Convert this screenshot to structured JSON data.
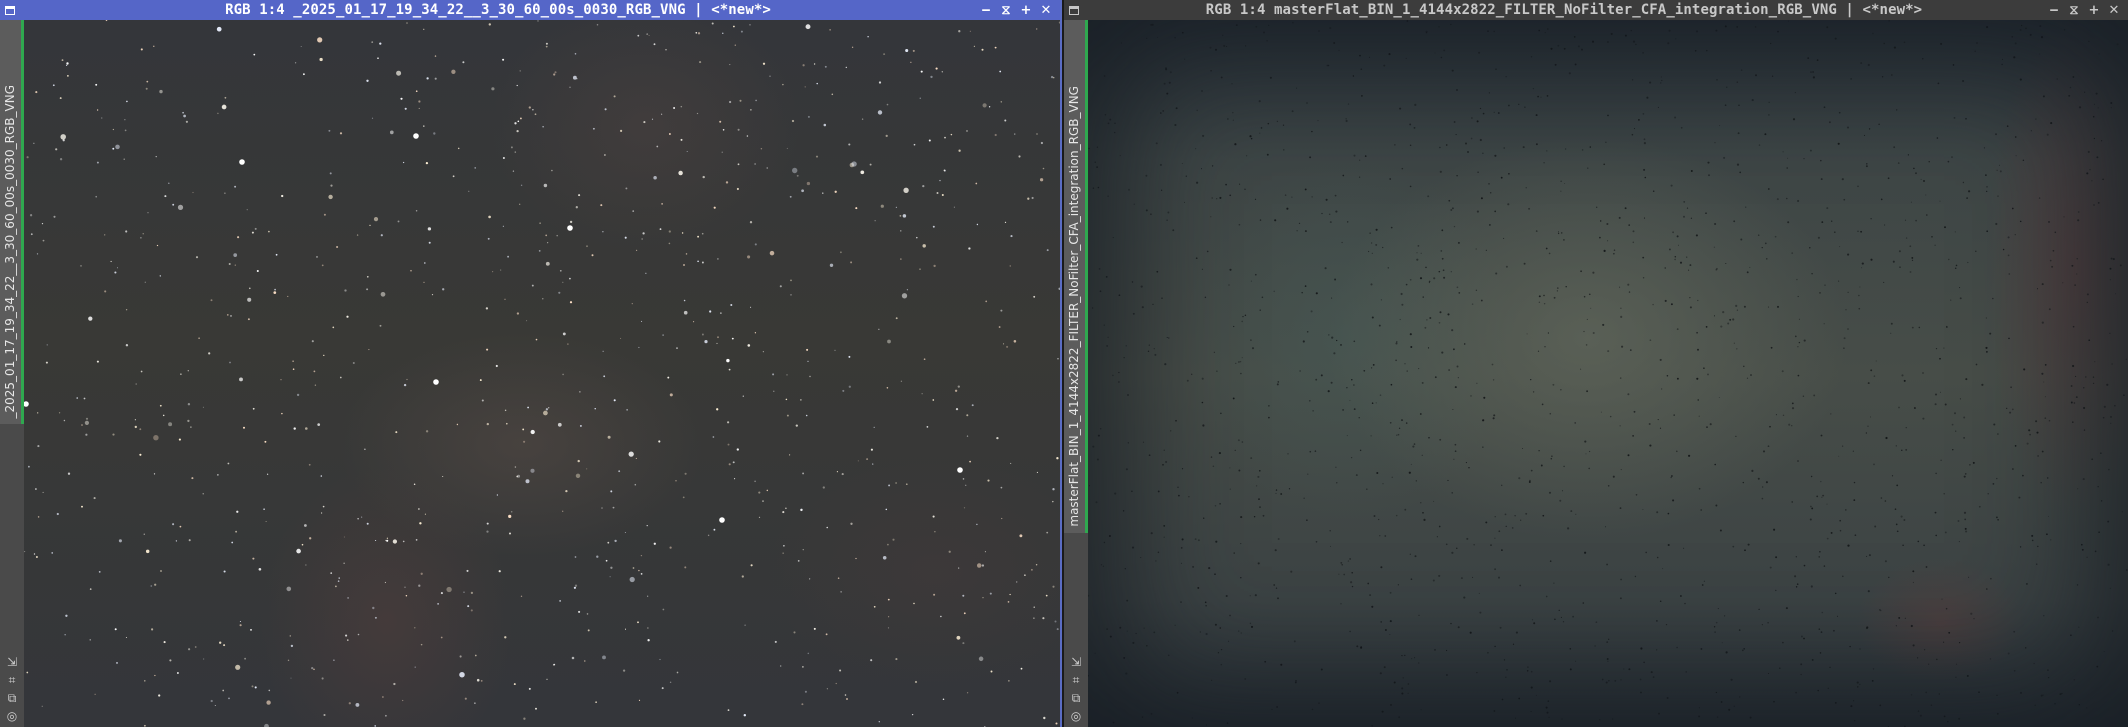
{
  "windows": [
    {
      "id": "left",
      "title": "RGB 1:4 _2025_01_17_19_34_22__3_30_60_00s_0030_RGB_VNG | <*new*>",
      "tab_label": "_2025_01_17_19_34_22__3_30_60_00s_0030_RGB_VNG",
      "active": true,
      "content": "star-field-image"
    },
    {
      "id": "right",
      "title": "RGB 1:4 masterFlat_BIN_1_4144x2822_FILTER_NoFilter_CFA_integration_RGB_VNG | <*new*>",
      "tab_label": "masterFlat_BIN_1_4144x2822_FILTER_NoFilter_CFA_integration_RGB_VNG",
      "active": false,
      "content": "master-flat-image"
    }
  ],
  "buttons": {
    "minimize": "‒",
    "shade": "⧖",
    "maximize": "+",
    "close": "✕"
  },
  "icons": [
    "shrink-icon",
    "fit-icon",
    "clone-icon",
    "target-icon"
  ],
  "colors": {
    "active_titlebar": "#5566c8",
    "inactive_titlebar": "#3c3c3c",
    "tab_accent": "#2fa84f"
  }
}
